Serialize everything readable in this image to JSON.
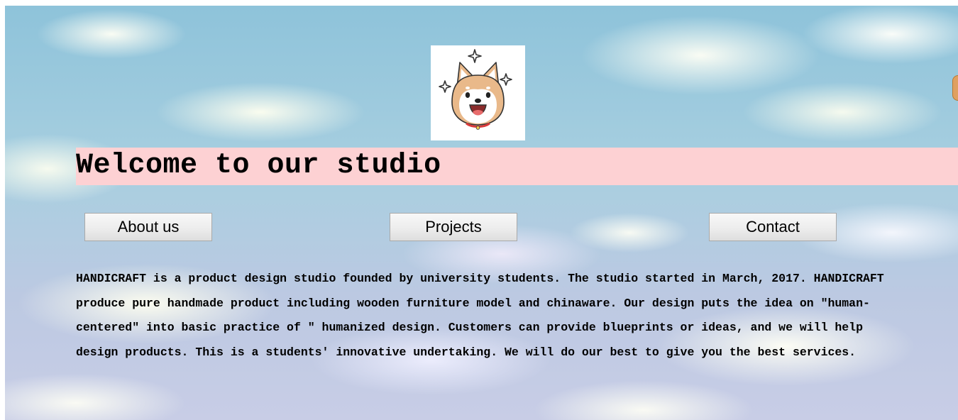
{
  "header": {
    "logo_icon": "shiba-dog-icon",
    "title": "Welcome to our studio",
    "title_band_color": "#fdd1d3"
  },
  "nav": {
    "buttons": [
      {
        "label": "About us"
      },
      {
        "label": "Projects"
      },
      {
        "label": "Contact"
      }
    ]
  },
  "main": {
    "intro": "HANDICRAFT is a product design studio founded by university students. The studio started in March, 2017. HANDICRAFT produce pure handmade product including wooden furniture model and chinaware. Our design puts the idea on \"human-centered\" into basic practice of \" humanized design. Customers can provide blueprints or ideas, and we will help design products. This is a students' innovative undertaking. We will do our best to give you the best services."
  },
  "background": {
    "image": "sky-clouds-background",
    "colors": [
      "#8ec3da",
      "#ffffff"
    ]
  }
}
